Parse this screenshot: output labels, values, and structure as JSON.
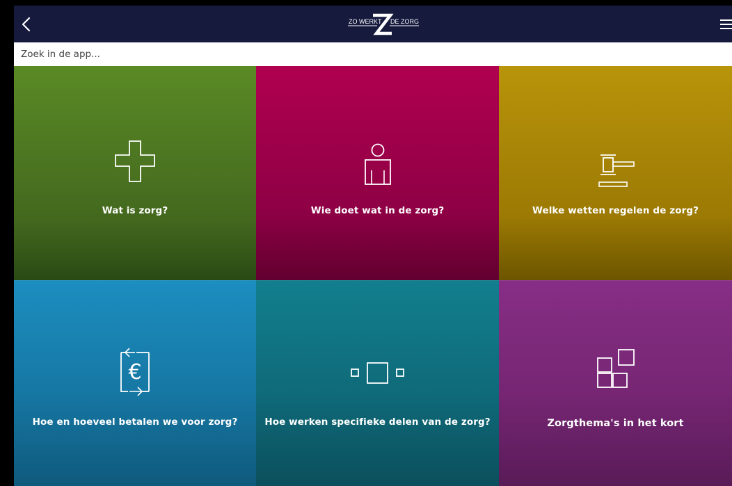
{
  "header": {
    "logo": {
      "left_text": "ZO WERKT",
      "center_letter": "Z",
      "right_text": "DE ZORG"
    },
    "back_icon": "chevron-left-icon",
    "menu_icon": "hamburger-menu-icon",
    "background": "#161b3e"
  },
  "search": {
    "placeholder": "Zoek in de app...",
    "value": ""
  },
  "tiles": [
    {
      "label": "Wat is zorg?",
      "icon": "plus-cross-icon",
      "color": "#4f7b22"
    },
    {
      "label": "Wie doet wat in de zorg?",
      "icon": "person-icon",
      "color": "#a1004b"
    },
    {
      "label": "Welke wetten regelen de zorg?",
      "icon": "gavel-icon",
      "color": "#a8860a"
    },
    {
      "label": "Hoe en hoeveel betalen we voor zorg?",
      "icon": "euro-exchange-icon",
      "color": "#1983b2"
    },
    {
      "label": "Hoe werken specifieke delen van de zorg?",
      "icon": "three-boxes-icon",
      "color": "#117584"
    },
    {
      "label": "Zorgthema's in het kort",
      "icon": "grid-squares-icon",
      "color": "#7f2a7e"
    }
  ]
}
